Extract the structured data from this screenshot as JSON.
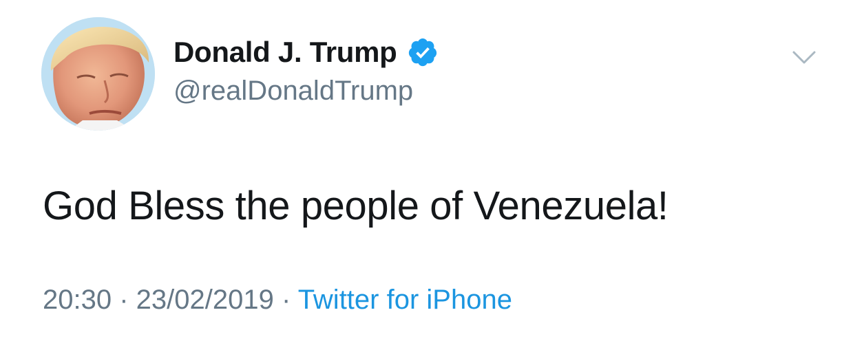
{
  "tweet": {
    "author": {
      "display_name": "Donald J. Trump",
      "handle": "@realDonaldTrump",
      "verified": true,
      "avatar_icon": "profile-photo"
    },
    "menu_icon": "chevron-down-icon",
    "text": "God Bless the people of Venezuela!",
    "meta": {
      "time": "20:30",
      "separator_1": " · ",
      "date": "23/02/2019",
      "separator_2": " · ",
      "source": "Twitter for iPhone"
    }
  },
  "colors": {
    "text_primary": "#14171a",
    "text_secondary": "#657786",
    "link": "#1b95e0",
    "verified_badge": "#1da1f2",
    "chevron": "#aab8c2"
  }
}
